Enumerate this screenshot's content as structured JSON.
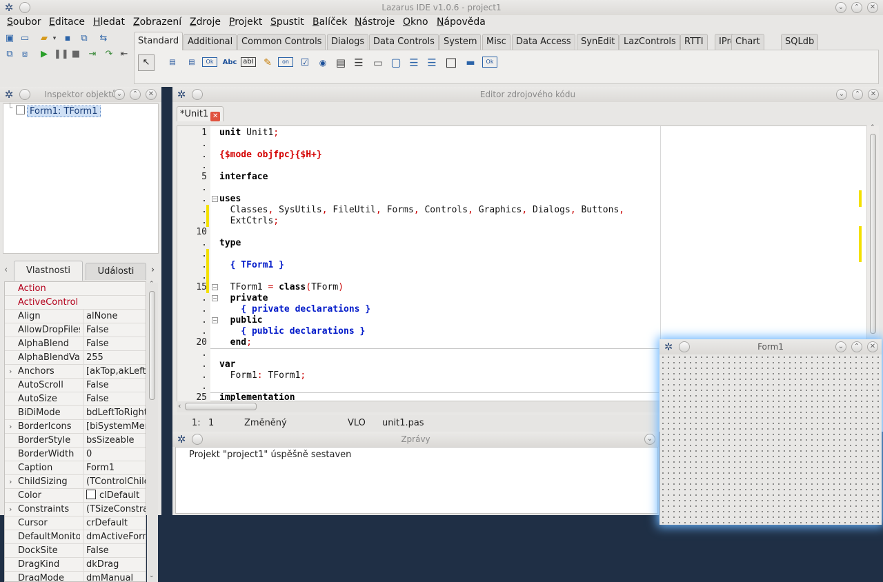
{
  "main_window": {
    "title": "Lazarus IDE v1.0.6 - project1",
    "menu": [
      {
        "first": "S",
        "rest": "oubor"
      },
      {
        "first": "E",
        "rest": "ditace"
      },
      {
        "first": "H",
        "rest": "ledat"
      },
      {
        "first": "Z",
        "rest": "obrazení"
      },
      {
        "first": "Z",
        "rest": "droje"
      },
      {
        "first": "P",
        "rest": "rojekt"
      },
      {
        "first": "S",
        "rest": "pustit"
      },
      {
        "first": "B",
        "rest": "alíček"
      },
      {
        "first": "N",
        "rest": "ástroje"
      },
      {
        "first": "O",
        "rest": "kno"
      },
      {
        "first": "N",
        "rest": "ápověda"
      }
    ],
    "palette_tabs": [
      "Standard",
      "Additional",
      "Common Controls",
      "Dialogs",
      "Data Controls",
      "System",
      "Misc",
      "Data Access",
      "SynEdit",
      "LazControls",
      "RTTI",
      "IPro",
      "Chart",
      "SQLdb"
    ],
    "active_palette_tab": "Standard",
    "palette_component_glyphs": [
      "▤",
      "▤",
      "Ok",
      "Abc",
      "abI",
      "✎",
      "on",
      "☑",
      "◉",
      "▤",
      "☰",
      "▭",
      "▢",
      "☰",
      "☰",
      "□",
      "▬",
      "Ok"
    ]
  },
  "inspector": {
    "title": "Inspektor objektů",
    "tree_item": "Form1: TForm1",
    "tabs": [
      "Vlastnosti",
      "Události"
    ],
    "properties": [
      {
        "name": "Action",
        "value": "",
        "event": true,
        "expandable": false
      },
      {
        "name": "ActiveControl",
        "value": "",
        "event": true,
        "expandable": false
      },
      {
        "name": "Align",
        "value": "alNone",
        "event": false,
        "expandable": false
      },
      {
        "name": "AllowDropFiles",
        "value": "False",
        "event": false,
        "expandable": false
      },
      {
        "name": "AlphaBlend",
        "value": "False",
        "event": false,
        "expandable": false
      },
      {
        "name": "AlphaBlendVal",
        "value": "255",
        "event": false,
        "expandable": false
      },
      {
        "name": "Anchors",
        "value": "[akTop,akLeft]",
        "event": false,
        "expandable": true
      },
      {
        "name": "AutoScroll",
        "value": "False",
        "event": false,
        "expandable": false
      },
      {
        "name": "AutoSize",
        "value": "False",
        "event": false,
        "expandable": false
      },
      {
        "name": "BiDiMode",
        "value": "bdLeftToRight",
        "event": false,
        "expandable": false
      },
      {
        "name": "BorderIcons",
        "value": "[biSystemMer",
        "event": false,
        "expandable": true
      },
      {
        "name": "BorderStyle",
        "value": "bsSizeable",
        "event": false,
        "expandable": false
      },
      {
        "name": "BorderWidth",
        "value": "0",
        "event": false,
        "expandable": false
      },
      {
        "name": "Caption",
        "value": "Form1",
        "event": false,
        "expandable": false
      },
      {
        "name": "ChildSizing",
        "value": "(TControlChild",
        "event": false,
        "expandable": true
      },
      {
        "name": "Color",
        "value": "clDefault",
        "event": false,
        "expandable": false,
        "swatch": "#ffffff"
      },
      {
        "name": "Constraints",
        "value": "(TSizeConstra",
        "event": false,
        "expandable": true
      },
      {
        "name": "Cursor",
        "value": "crDefault",
        "event": false,
        "expandable": false
      },
      {
        "name": "DefaultMonito",
        "value": "dmActiveForm",
        "event": false,
        "expandable": false
      },
      {
        "name": "DockSite",
        "value": "False",
        "event": false,
        "expandable": false
      },
      {
        "name": "DragKind",
        "value": "dkDrag",
        "event": false,
        "expandable": false
      },
      {
        "name": "DragMode",
        "value": "dmManual",
        "event": false,
        "expandable": false
      }
    ]
  },
  "editor": {
    "title": "Editor zdrojového kódu",
    "tab_label": "*Unit1",
    "gutter": [
      "1",
      ".",
      ".",
      ".",
      "5",
      ".",
      ".",
      ".",
      ".",
      "10",
      ".",
      ".",
      ".",
      ".",
      "15",
      ".",
      ".",
      ".",
      ".",
      "20",
      ".",
      ".",
      ".",
      ".",
      "25"
    ],
    "code_lines": [
      [
        {
          "t": "unit",
          "c": "kw"
        },
        {
          "t": " Unit1",
          "c": ""
        },
        {
          "t": ";",
          "c": "sym"
        }
      ],
      [],
      [
        {
          "t": "{$mode objfpc}{$H+}",
          "c": "dir"
        }
      ],
      [],
      [
        {
          "t": "interface",
          "c": "kw"
        }
      ],
      [],
      [
        {
          "t": "uses",
          "c": "kw"
        }
      ],
      [
        {
          "t": "  Classes",
          "c": ""
        },
        {
          "t": ",",
          "c": "sym"
        },
        {
          "t": " SysUtils",
          "c": ""
        },
        {
          "t": ",",
          "c": "sym"
        },
        {
          "t": " FileUtil",
          "c": ""
        },
        {
          "t": ",",
          "c": "sym"
        },
        {
          "t": " Forms",
          "c": ""
        },
        {
          "t": ",",
          "c": "sym"
        },
        {
          "t": " Controls",
          "c": ""
        },
        {
          "t": ",",
          "c": "sym"
        },
        {
          "t": " Graphics",
          "c": ""
        },
        {
          "t": ",",
          "c": "sym"
        },
        {
          "t": " Dialogs",
          "c": ""
        },
        {
          "t": ",",
          "c": "sym"
        },
        {
          "t": " Buttons",
          "c": ""
        },
        {
          "t": ",",
          "c": "sym"
        }
      ],
      [
        {
          "t": "  ExtCtrls",
          "c": ""
        },
        {
          "t": ";",
          "c": "sym"
        }
      ],
      [],
      [
        {
          "t": "type",
          "c": "kw"
        }
      ],
      [],
      [
        {
          "t": "  { TForm1 }",
          "c": "cm"
        }
      ],
      [],
      [
        {
          "t": "  TForm1 ",
          "c": ""
        },
        {
          "t": "=",
          "c": "sym"
        },
        {
          "t": " class",
          "c": "kw"
        },
        {
          "t": "(",
          "c": "sym"
        },
        {
          "t": "TForm",
          "c": ""
        },
        {
          "t": ")",
          "c": "sym"
        }
      ],
      [
        {
          "t": "  private",
          "c": "kw"
        }
      ],
      [
        {
          "t": "    { private declarations }",
          "c": "cm"
        }
      ],
      [
        {
          "t": "  public",
          "c": "kw"
        }
      ],
      [
        {
          "t": "    { public declarations }",
          "c": "cm"
        }
      ],
      [
        {
          "t": "  end",
          "c": "kw"
        },
        {
          "t": ";",
          "c": "sym"
        }
      ],
      [],
      [
        {
          "t": "var",
          "c": "kw"
        }
      ],
      [
        {
          "t": "  Form1",
          "c": ""
        },
        {
          "t": ":",
          "c": "sym"
        },
        {
          "t": " TForm1",
          "c": ""
        },
        {
          "t": ";",
          "c": "sym"
        }
      ],
      [],
      [
        {
          "t": "implementation",
          "c": "kw"
        }
      ]
    ],
    "status": {
      "pos_line": "1:",
      "pos_col": "1",
      "modified": "Změněný",
      "mode": "VLO",
      "file": "unit1.pas"
    }
  },
  "messages": {
    "title": "Zprávy",
    "line": "Projekt \"project1\" úspěšně sestaven"
  },
  "form1": {
    "title": "Form1"
  }
}
